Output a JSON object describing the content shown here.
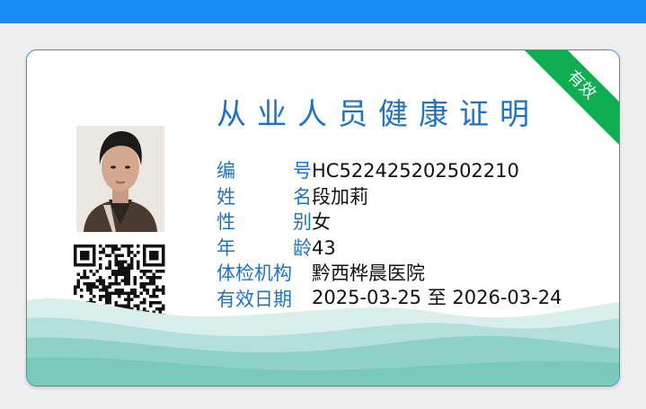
{
  "app": {
    "bar_color": "#1a8cf5"
  },
  "certificate": {
    "title": "从业人员健康证明",
    "status_ribbon": "有效",
    "status_color": "#0fae52",
    "label_color": "#1c73c7",
    "photo": {
      "icon": "person-portrait-icon"
    },
    "qr_code": {
      "icon": "qr-code-icon"
    },
    "fields": [
      {
        "label_chars": [
          "编",
          "号"
        ],
        "value": "HC522425202502210"
      },
      {
        "label_chars": [
          "姓",
          "名"
        ],
        "value": "段加莉"
      },
      {
        "label_chars": [
          "性",
          "别"
        ],
        "value": "女"
      },
      {
        "label_chars": [
          "年",
          "龄"
        ],
        "value": "43"
      },
      {
        "label_chars": [
          "体检机构"
        ],
        "value": "黔西桦晨医院"
      },
      {
        "label_chars": [
          "有效日期"
        ],
        "value": "2025-03-25 至 2026-03-24"
      }
    ]
  }
}
